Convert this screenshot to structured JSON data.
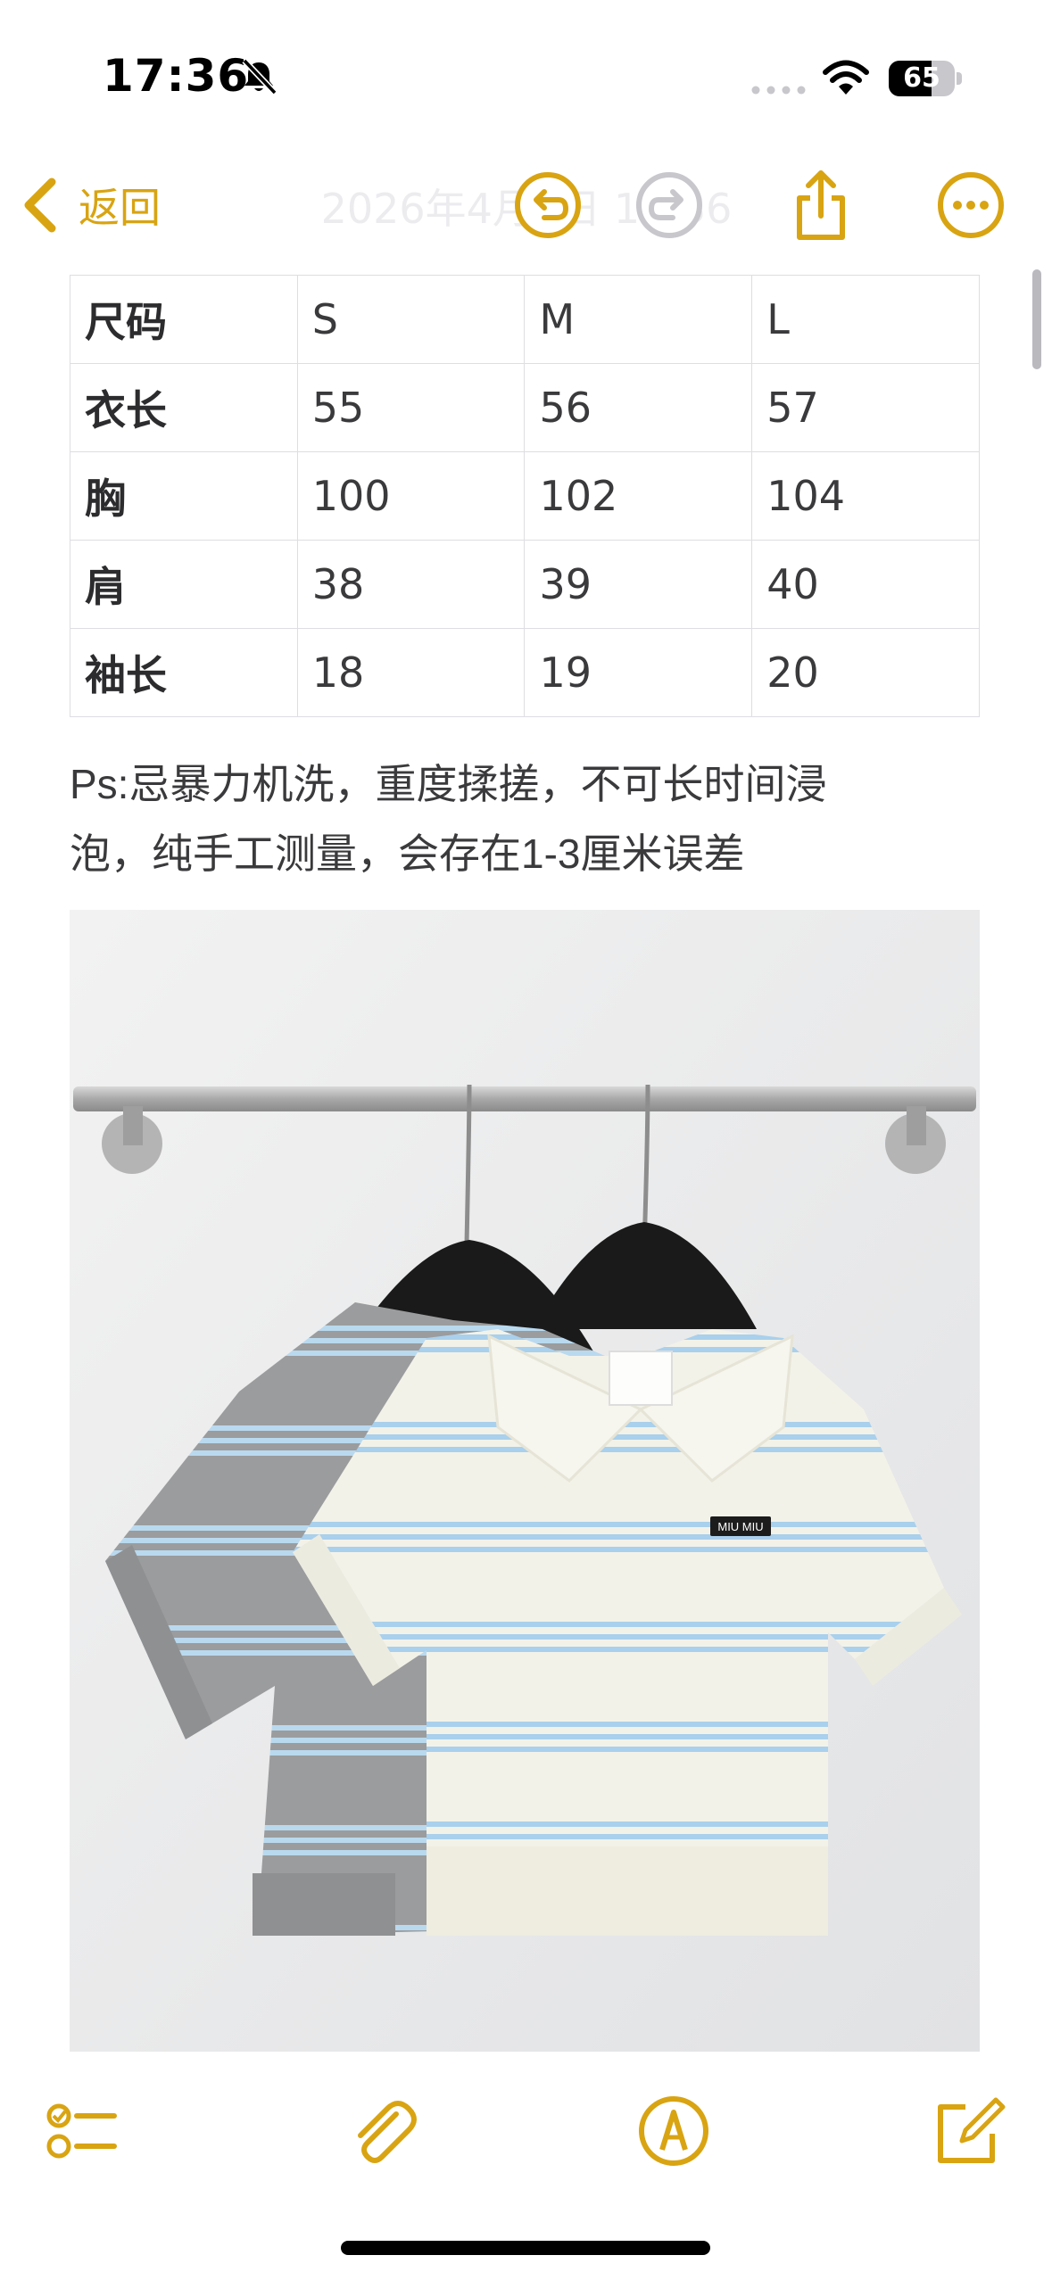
{
  "status_bar": {
    "time": "17:36",
    "battery_percent": "65",
    "battery_level": 0.65
  },
  "nav": {
    "back_label": "返回",
    "title": "2026年4月1日 17:36",
    "icons": [
      "chevron-left-icon",
      "undo-icon",
      "redo-icon",
      "share-icon",
      "more-icon"
    ]
  },
  "size_table": {
    "rows": [
      [
        "尺码",
        "S",
        "M",
        "L"
      ],
      [
        "衣长",
        "55",
        "56",
        "57"
      ],
      [
        "胸",
        "100",
        "102",
        "104"
      ],
      [
        "肩",
        "38",
        "39",
        "40"
      ],
      [
        "袖长",
        "18",
        "19",
        "20"
      ]
    ]
  },
  "note": {
    "line1": "Ps:忌暴力机洗，重度揉搓，不可长时间浸",
    "line2": "泡，纯手工测量，会存在1-3厘米误差"
  },
  "photo": {
    "label_text": "MIU MIU"
  },
  "toolbar": {
    "icons": [
      "checklist-icon",
      "paperclip-icon",
      "markup-icon",
      "compose-icon"
    ]
  },
  "colors": {
    "accent": "#d9a412",
    "text": "#3a3a3c",
    "table_border": "#dedee3"
  }
}
